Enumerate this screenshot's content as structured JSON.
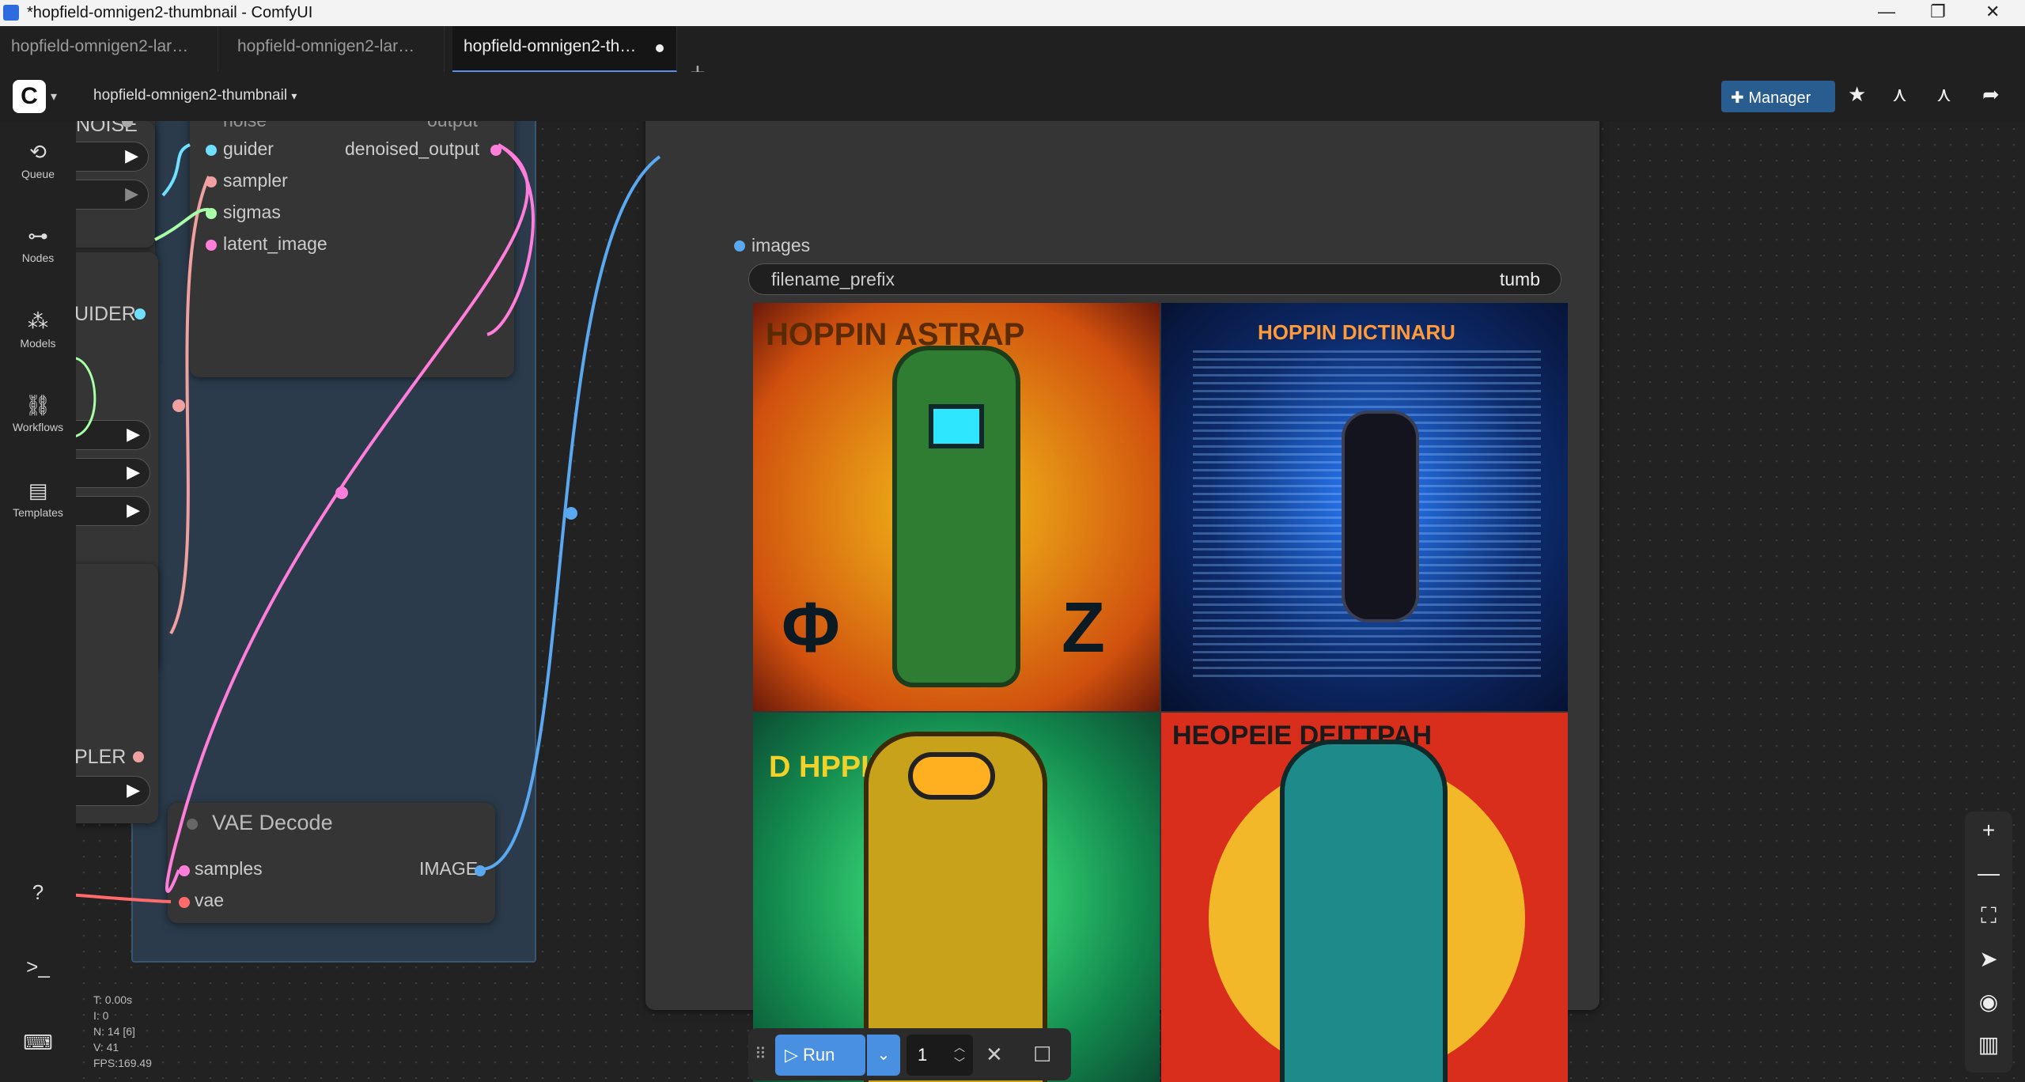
{
  "window": {
    "title": "*hopfield-omnigen2-thumbnail - ComfyUI"
  },
  "tabs": [
    {
      "label": "hopfield-omnigen2-lar…"
    },
    {
      "label": "hopfield-omnigen2-lar…"
    },
    {
      "label": "hopfield-omnigen2-th…"
    }
  ],
  "toolbar": {
    "workflow_name": "hopfield-omnigen2-thumbnail",
    "manager_label": "Manager"
  },
  "sidebar": {
    "items": [
      {
        "label": "Queue"
      },
      {
        "label": "Nodes"
      },
      {
        "label": "Models"
      },
      {
        "label": "Workflows"
      },
      {
        "label": "Templates"
      }
    ]
  },
  "nodes": {
    "left_partial": {
      "noise_label": "NOISE",
      "guider_label": "UIDER",
      "sampler_label": "PLER"
    },
    "sampler": {
      "noise": "noise",
      "output": "output",
      "guider": "guider",
      "sampler": "sampler",
      "sigmas": "sigmas",
      "latent_image": "latent_image",
      "denoised_output": "denoised_output"
    },
    "vae_decode": {
      "title": "VAE Decode",
      "samples": "samples",
      "vae": "vae",
      "image": "IMAGE"
    },
    "save_image": {
      "images": "images",
      "filename_prefix_label": "filename_prefix",
      "filename_prefix_value": "tumb"
    }
  },
  "preview_images": [
    {
      "caption": "HOPPIN ASTRAP"
    },
    {
      "caption": "HOPPIN DICTINARU"
    },
    {
      "caption": "D HPPIR HANRER"
    },
    {
      "caption": "HEOPEIE DEITTPAH"
    }
  ],
  "stats": {
    "t": "T: 0.00s",
    "i": "I: 0",
    "n": "N: 14 [6]",
    "v": "V: 41",
    "fps": "FPS:169.49"
  },
  "runbar": {
    "run_label": "Run",
    "batch_count": "1"
  },
  "colors": {
    "accent": "#4a90e2",
    "link_pink": "#e87ee8",
    "link_blue": "#5aa8f0",
    "link_salmon": "#e8a0a0"
  }
}
